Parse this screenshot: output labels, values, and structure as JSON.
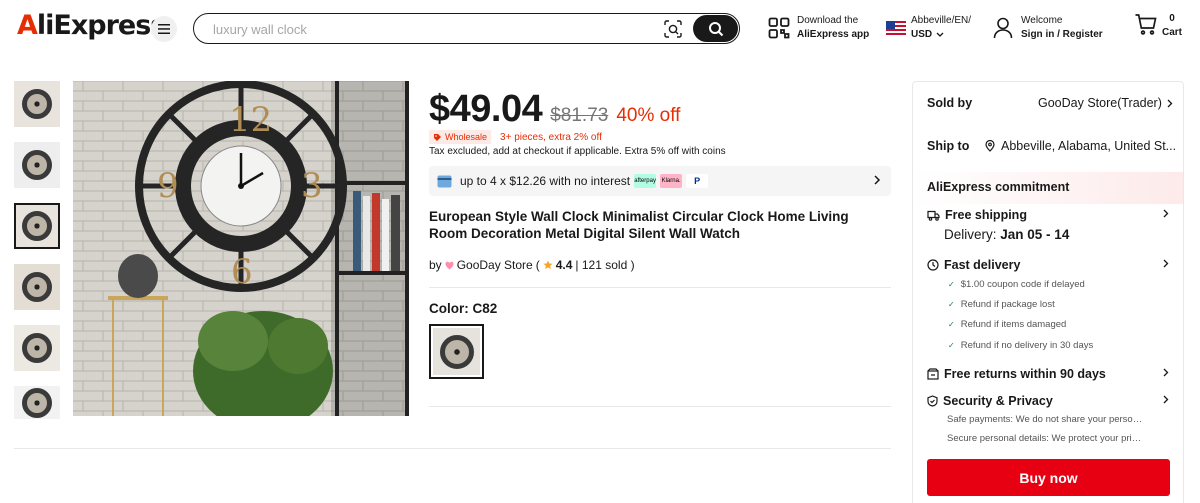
{
  "header": {
    "logo_a": "A",
    "logo_rest": "liExpress",
    "search_placeholder": "luxury wall clock",
    "download_line1": "Download the",
    "download_line2": "AliExpress app",
    "locale": "Abbeville/EN/",
    "currency": "USD",
    "welcome": "Welcome",
    "sign_in": "Sign in / Register",
    "cart_count": "0",
    "cart_label": "Cart"
  },
  "product": {
    "price": "$49.04",
    "original_price": "$81.73",
    "discount": "40% off",
    "wholesale_label": "Wholesale",
    "pieces_offer": "3+ pieces, extra 2% off",
    "tax_note": "Tax excluded, add at checkout if applicable. Extra 5% off with coins",
    "installment": "up to 4 x $12.26 with no interest",
    "pay_badges": [
      "afterpay",
      "Klarna.",
      "P"
    ],
    "title": "European Style Wall Clock Minimalist Circular Clock Home Living Room Decoration Metal Digital Silent Wall Watch",
    "store_prefix": "by",
    "store_name": "GooDay Store",
    "store_paren_open": "(",
    "rating": "4.4",
    "sold_text": "| 121 sold )",
    "color_label": "Color: C82"
  },
  "panel": {
    "sold_by_label": "Sold by",
    "sold_by_value": "GooDay Store(Trader)",
    "ship_to_label": "Ship to",
    "ship_to_value": "Abbeville, Alabama, United St...",
    "commitment": "AliExpress commitment",
    "free_shipping": "Free shipping",
    "delivery_label": "Delivery:",
    "delivery_date": "Jan 05 - 14",
    "fast_delivery": "Fast delivery",
    "guarantees": [
      "$1.00 coupon code if delayed",
      "Refund if package lost",
      "Refund if items damaged",
      "Refund if no delivery in 30 days"
    ],
    "free_returns": "Free returns within 90 days",
    "security": "Security & Privacy",
    "security_line1": "Safe payments: We do not share your personal details",
    "security_line2": "Secure personal details: We protect your privacy",
    "buy_now": "Buy now"
  },
  "colors": {
    "accent_red": "#e62e04",
    "buy_red": "#e60012",
    "text_dark": "#191919"
  },
  "icons": [
    "menu-icon",
    "camera-search-icon",
    "search-icon",
    "qr-code-icon",
    "us-flag-icon",
    "user-icon",
    "cart-icon",
    "wholesale-icon",
    "installment-icon",
    "star-icon",
    "chevron-right-icon",
    "location-icon",
    "truck-icon",
    "clock-icon",
    "return-icon",
    "shield-icon",
    "check-icon"
  ]
}
